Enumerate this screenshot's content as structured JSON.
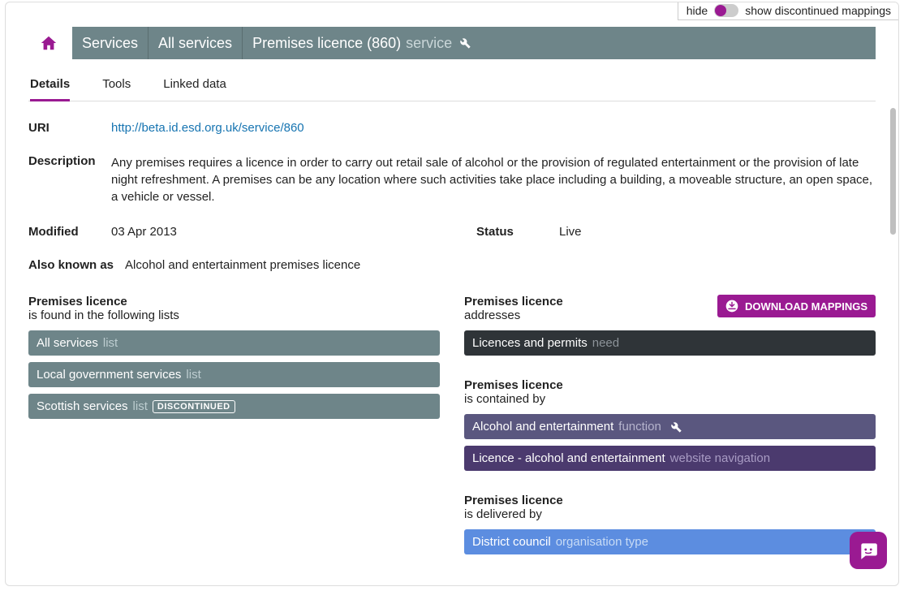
{
  "topbar": {
    "hide": "hide",
    "show": "show discontinued mappings"
  },
  "breadcrumb": {
    "seg1": "Services",
    "seg2": "All services",
    "seg3": "Premises licence (860)",
    "seg3_type": "service"
  },
  "tabs": {
    "details": "Details",
    "tools": "Tools",
    "linked": "Linked data"
  },
  "fields": {
    "uri_label": "URI",
    "uri_value": "http://beta.id.esd.org.uk/service/860",
    "description_label": "Description",
    "description_value": "Any premises requires a licence in order to carry out retail sale of alcohol or the provision of regulated entertainment or the provision of late night refreshment. A premises can be any location where such activities take place including a building, a moveable structure, an open space, a vehicle or vessel.",
    "modified_label": "Modified",
    "modified_value": "03 Apr 2013",
    "status_label": "Status",
    "status_value": "Live",
    "aka_label": "Also known as",
    "aka_value": "Alcohol and entertainment premises licence"
  },
  "left": {
    "lists_head": "Premises licence",
    "lists_sub": "is found in the following lists",
    "list_items": [
      {
        "name": "All services",
        "type": "list",
        "discontinued": false
      },
      {
        "name": "Local government services",
        "type": "list",
        "discontinued": false
      },
      {
        "name": "Scottish services",
        "type": "list",
        "discontinued": true
      }
    ],
    "discont_label": "DISCONTINUED"
  },
  "right": {
    "addresses_head": "Premises licence",
    "addresses_sub": "addresses",
    "addresses_items": [
      {
        "name": "Licences and permits",
        "type": "need"
      }
    ],
    "download": "DOWNLOAD MAPPINGS",
    "contained_head": "Premises licence",
    "contained_sub": "is contained by",
    "contained_items": [
      {
        "name": "Alcohol and entertainment",
        "type": "function",
        "wrench": true,
        "cls": "violet"
      },
      {
        "name": "Licence - alcohol and entertainment",
        "type": "website navigation",
        "wrench": false,
        "cls": "purple"
      }
    ],
    "delivered_head": "Premises licence",
    "delivered_sub": "is delivered by",
    "delivered_items": [
      {
        "name": "District council",
        "type": "organisation type"
      }
    ]
  }
}
